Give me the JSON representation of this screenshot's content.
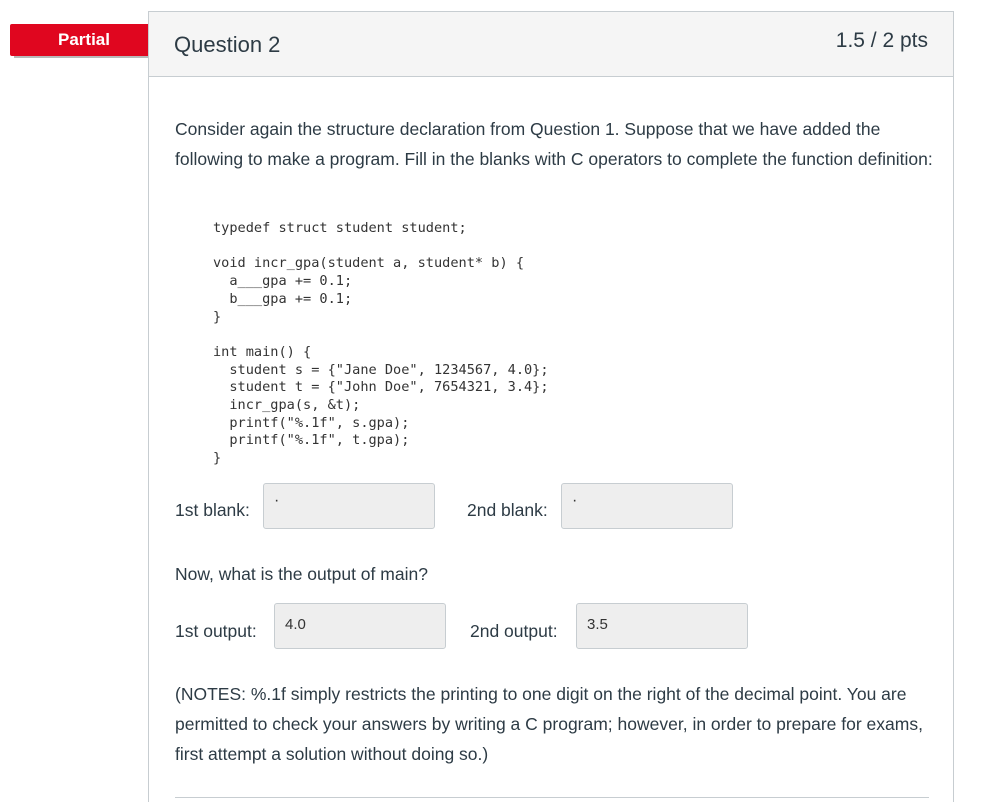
{
  "ribbon": {
    "label": "Partial",
    "color": "#e0061f"
  },
  "question": {
    "title": "Question 2",
    "points": "1.5 / 2 pts",
    "intro": "Consider again the structure declaration from Question 1.  Suppose that we have added the following to make a program.  Fill in the blanks with C operators to complete the function definition:",
    "blank1_label": "1st blank:",
    "blank1_value": "·",
    "blank2_label": "2nd blank:",
    "blank2_value": "·",
    "output_prompt": "Now, what is the output of main?",
    "output1_label": "1st output:",
    "output1_value": "4.0",
    "output2_label": "2nd output:",
    "output2_value": "3.5",
    "notes": "(NOTES: %.1f simply restricts the printing to one digit on the right of the decimal point.  You are permitted to check your answers by writing a C program; however, in order to prepare for exams, first attempt a solution without doing so.)"
  },
  "code": {
    "line1": "typedef struct student student;",
    "line2": "void incr_gpa(student a, student* b) {",
    "line3": "  a___gpa += 0.1;",
    "line4": "  b___gpa += 0.1;",
    "line5": "}",
    "line6": "int main() {",
    "line7": "  student s = {\"Jane Doe\", 1234567, 4.0};",
    "line8": "  student t = {\"John Doe\", 7654321, 3.4};",
    "line9": "  incr_gpa(s, &t);",
    "line10": "  printf(\"%.1f\", s.gpa);",
    "line11": "  printf(\"%.1f\", t.gpa);",
    "line12": "}"
  }
}
